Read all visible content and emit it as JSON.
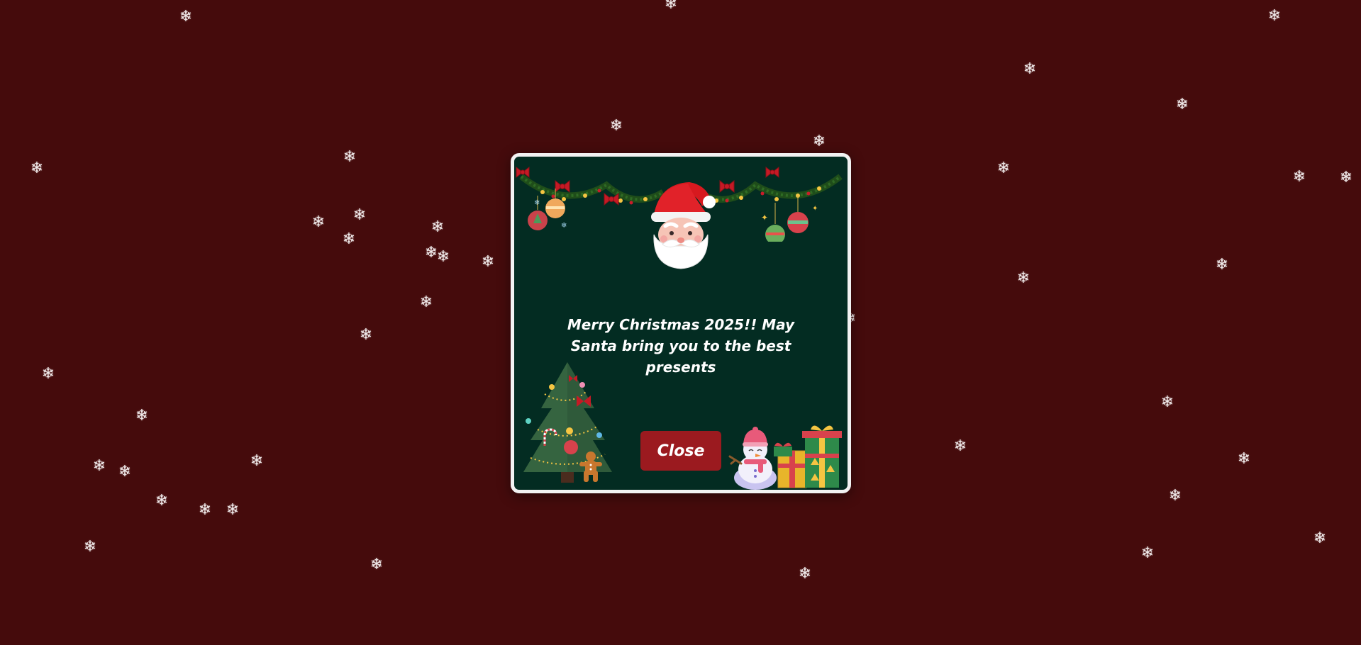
{
  "page": {
    "background_color": "#450b0c",
    "snowflake_glyph": "❄",
    "snowflake_color": "#f3eded"
  },
  "popup": {
    "background_color": "#032c22",
    "border_color": "#f2f2f2",
    "message": "Merry Christmas 2025!! May Santa bring you to the best presents",
    "close_label": "Close",
    "close_button_color": "#9b1a1f",
    "decorations": [
      "garland-with-bows",
      "santa-icon",
      "christmas-ornaments-icon",
      "christmas-tree-icon",
      "gingerbread-man-icon",
      "snowman-icon",
      "gift-boxes-icon"
    ]
  }
}
